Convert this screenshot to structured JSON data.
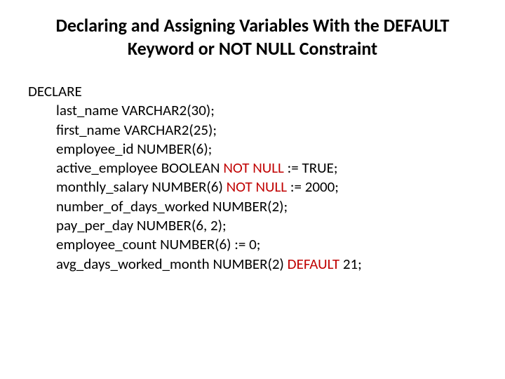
{
  "title": "Declaring and Assigning Variables With the DEFAULT Keyword or NOT NULL Constraint",
  "declare_kw": "DECLARE",
  "lines": [
    {
      "pre": "last_name VARCHAR2(30);",
      "mid": "",
      "post": ""
    },
    {
      "pre": "first_name VARCHAR2(25);",
      "mid": "",
      "post": ""
    },
    {
      "pre": "employee_id NUMBER(6);",
      "mid": "",
      "post": ""
    },
    {
      "pre": "active_employee BOOLEAN ",
      "mid": "NOT NULL",
      "post": " := TRUE;"
    },
    {
      "pre": "monthly_salary NUMBER(6) ",
      "mid": "NOT NULL",
      "post": " := 2000;"
    },
    {
      "pre": "number_of_days_worked NUMBER(2);",
      "mid": "",
      "post": ""
    },
    {
      "pre": "pay_per_day NUMBER(6, 2);",
      "mid": "",
      "post": ""
    },
    {
      "pre": "employee_count NUMBER(6) := 0;",
      "mid": "",
      "post": ""
    },
    {
      "pre": "avg_days_worked_month NUMBER(2) ",
      "mid": "DEFAULT",
      "post": " 21;"
    }
  ]
}
